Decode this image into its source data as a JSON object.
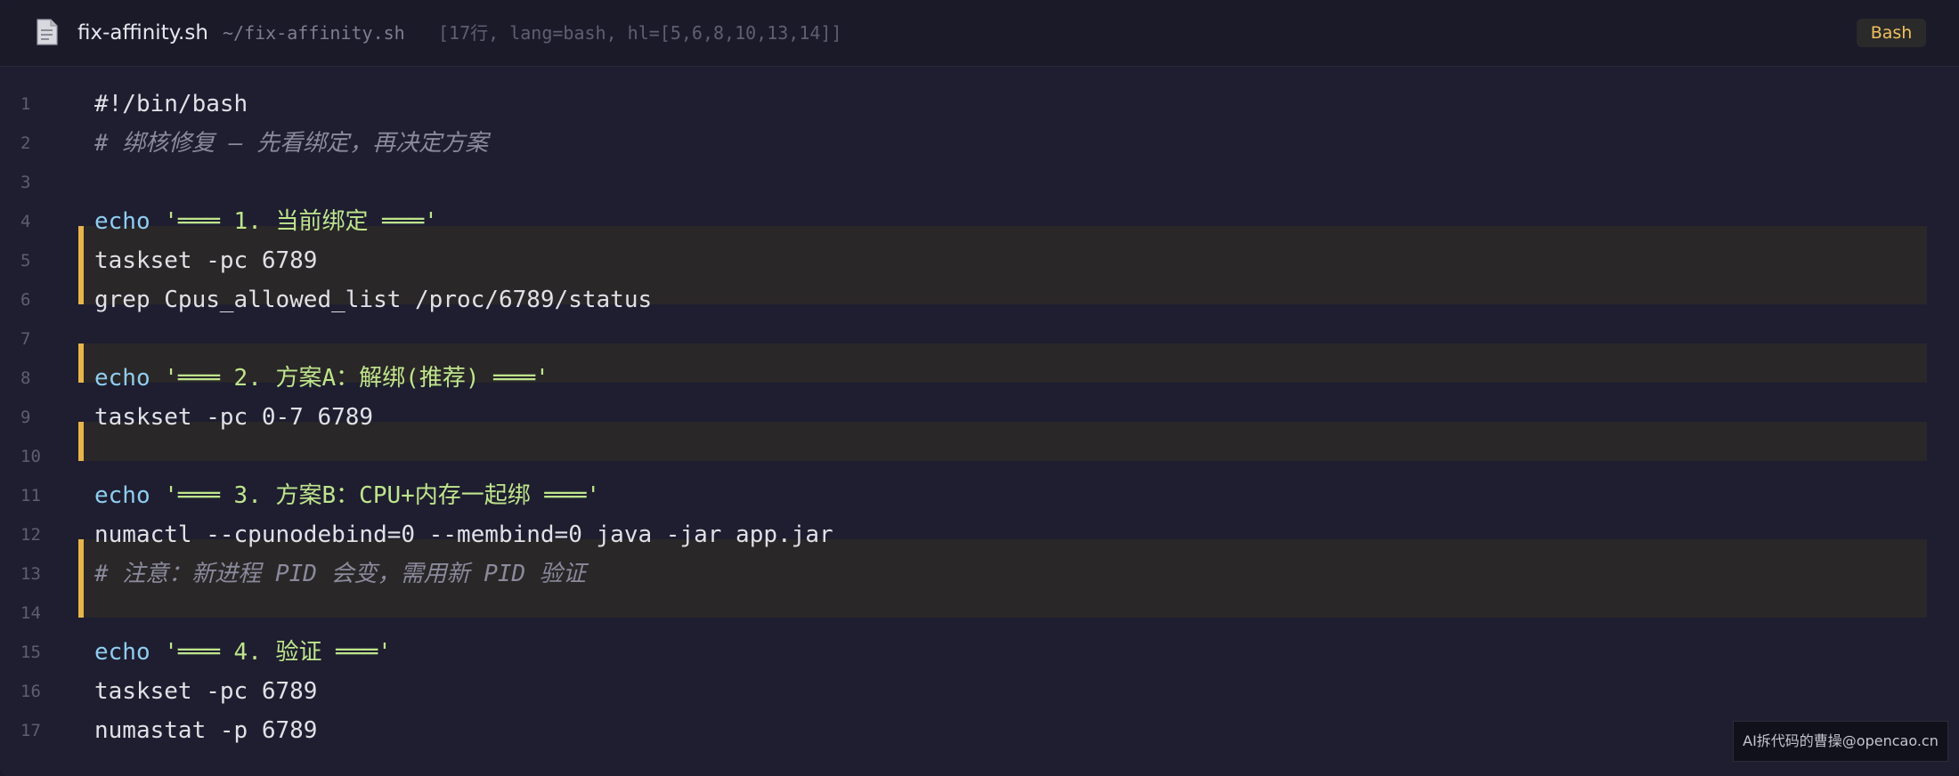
{
  "header": {
    "file_icon": "document-icon",
    "filename": "fix-affinity.sh",
    "path": "~/fix-affinity.sh",
    "info": "[17行, lang=bash, hl=[5,6,8,10,13,14]]",
    "language_badge": "Bash"
  },
  "colors": {
    "highlight_bar": "#e7b54a",
    "keyword": "#8fcdf0",
    "string": "#bfe58c",
    "comment": "#8a8a9c"
  },
  "code": {
    "highlighted_lines": [
      5,
      6,
      8,
      10,
      13,
      14
    ],
    "lines": [
      {
        "num": "1",
        "tokens": [
          {
            "type": "plain",
            "text": "#!/bin/bash"
          }
        ]
      },
      {
        "num": "2",
        "tokens": [
          {
            "type": "cm",
            "text": "# 绑核修复 — 先看绑定，再决定方案"
          }
        ]
      },
      {
        "num": "3",
        "tokens": []
      },
      {
        "num": "4",
        "tokens": [
          {
            "type": "kw",
            "text": "echo"
          },
          {
            "type": "plain",
            "text": " "
          },
          {
            "type": "str",
            "text": "'═══ 1. 当前绑定 ═══'"
          }
        ]
      },
      {
        "num": "5",
        "tokens": [
          {
            "type": "plain",
            "text": "taskset -pc 6789"
          }
        ]
      },
      {
        "num": "6",
        "tokens": [
          {
            "type": "plain",
            "text": "grep Cpus_allowed_list /proc/6789/status"
          }
        ]
      },
      {
        "num": "7",
        "tokens": []
      },
      {
        "num": "8",
        "tokens": [
          {
            "type": "kw",
            "text": "echo"
          },
          {
            "type": "plain",
            "text": " "
          },
          {
            "type": "str",
            "text": "'═══ 2. 方案A：解绑(推荐) ═══'"
          }
        ]
      },
      {
        "num": "9",
        "tokens": [
          {
            "type": "plain",
            "text": "taskset -pc 0-7 6789"
          }
        ]
      },
      {
        "num": "10",
        "tokens": []
      },
      {
        "num": "11",
        "tokens": [
          {
            "type": "kw",
            "text": "echo"
          },
          {
            "type": "plain",
            "text": " "
          },
          {
            "type": "str",
            "text": "'═══ 3. 方案B：CPU+内存一起绑 ═══'"
          }
        ]
      },
      {
        "num": "12",
        "tokens": [
          {
            "type": "plain",
            "text": "numactl --cpunodebind=0 --membind=0 java -jar app.jar"
          }
        ]
      },
      {
        "num": "13",
        "tokens": [
          {
            "type": "cm",
            "text": "# 注意：新进程 PID 会变，需用新 PID 验证"
          }
        ]
      },
      {
        "num": "14",
        "tokens": []
      },
      {
        "num": "15",
        "tokens": [
          {
            "type": "kw",
            "text": "echo"
          },
          {
            "type": "plain",
            "text": " "
          },
          {
            "type": "str",
            "text": "'═══ 4. 验证 ═══'"
          }
        ]
      },
      {
        "num": "16",
        "tokens": [
          {
            "type": "plain",
            "text": "taskset -pc 6789"
          }
        ]
      },
      {
        "num": "17",
        "tokens": [
          {
            "type": "plain",
            "text": "numastat -p 6789"
          }
        ]
      }
    ]
  },
  "watermark": "AI拆代码的曹操@opencao.cn"
}
